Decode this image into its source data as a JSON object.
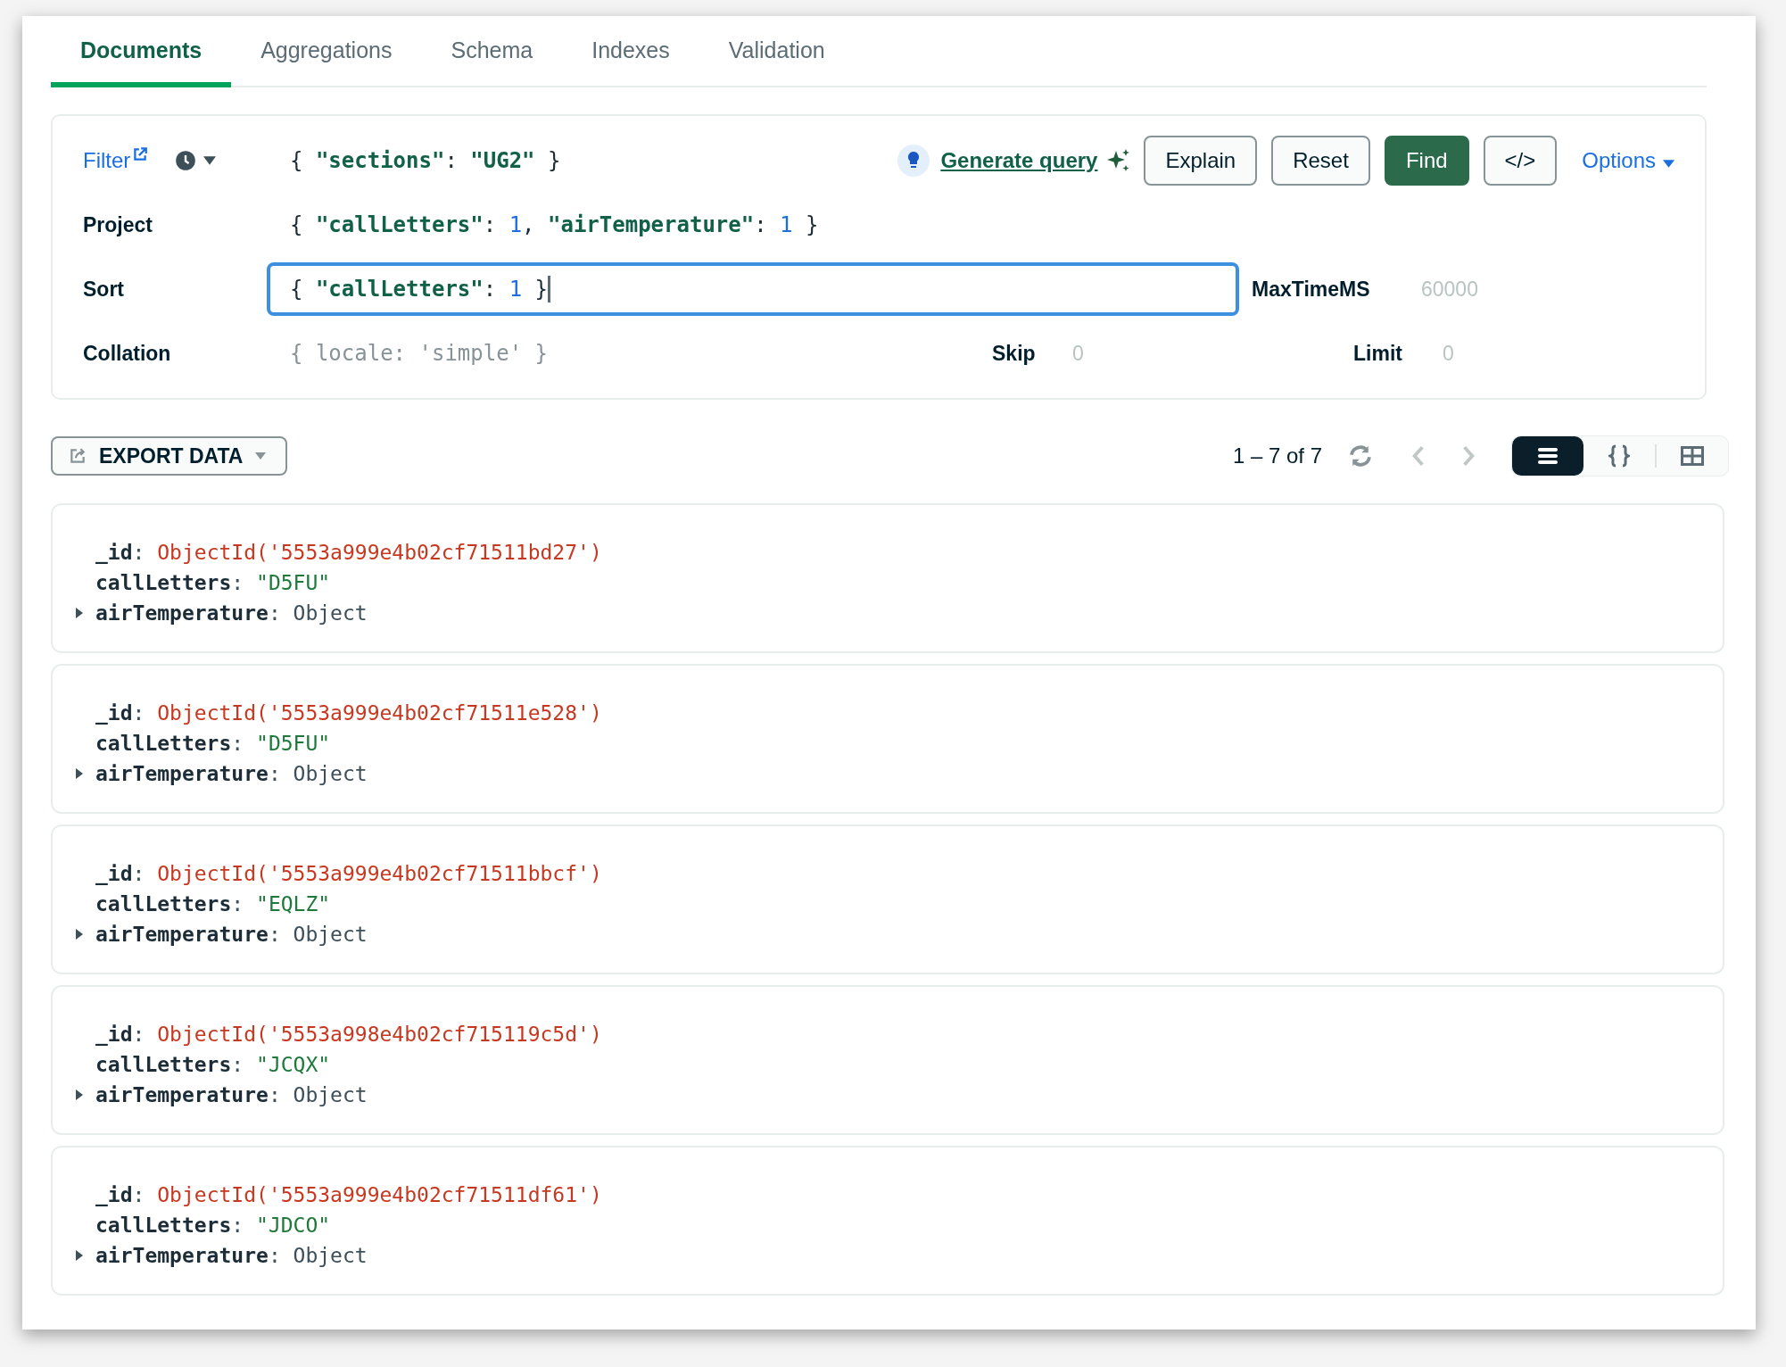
{
  "tabs": [
    {
      "label": "Documents",
      "selected": true
    },
    {
      "label": "Aggregations",
      "selected": false
    },
    {
      "label": "Schema",
      "selected": false
    },
    {
      "label": "Indexes",
      "selected": false
    },
    {
      "label": "Validation",
      "selected": false
    }
  ],
  "query": {
    "filter": {
      "label": "Filter",
      "value": "{ \"sections\": \"UG2\" }"
    },
    "generate_link": "Generate query",
    "buttons": [
      {
        "label": "Explain",
        "kind": "outline"
      },
      {
        "label": "Reset",
        "kind": "outline"
      },
      {
        "label": "Find",
        "kind": "primary"
      },
      {
        "label": "</>",
        "kind": "outline"
      }
    ],
    "options": "Options",
    "project": {
      "label": "Project",
      "value": "{ \"callLetters\": 1, \"airTemperature\": 1 }"
    },
    "sort": {
      "label": "Sort",
      "value": "{ \"callLetters\": 1 }",
      "focused": true
    },
    "maxtime": {
      "label": "MaxTimeMS",
      "placeholder": "60000"
    },
    "collation": {
      "label": "Collation",
      "placeholder": "{ locale: 'simple' }"
    },
    "skip": {
      "label": "Skip",
      "placeholder": "0"
    },
    "limit": {
      "label": "Limit",
      "placeholder": "0"
    }
  },
  "export_button": "EXPORT DATA",
  "pagination": "1 – 7 of 7",
  "views": [
    {
      "kind": "list",
      "selected": true
    },
    {
      "kind": "json",
      "selected": false
    },
    {
      "kind": "table",
      "selected": false
    }
  ],
  "documents": [
    {
      "fields": [
        {
          "key": "_id",
          "sep": ":",
          "value": "ObjectId('5553a999e4b02cf71511bd27')",
          "kind": "objectid"
        },
        {
          "key": "callLetters",
          "sep": ":",
          "value": "\"D5FU\"",
          "kind": "string"
        },
        {
          "key": "airTemperature",
          "sep": ":",
          "value": "Object",
          "kind": "object"
        }
      ]
    },
    {
      "fields": [
        {
          "key": "_id",
          "sep": ":",
          "value": "ObjectId('5553a999e4b02cf71511e528')",
          "kind": "objectid"
        },
        {
          "key": "callLetters",
          "sep": ":",
          "value": "\"D5FU\"",
          "kind": "string"
        },
        {
          "key": "airTemperature",
          "sep": ":",
          "value": "Object",
          "kind": "object"
        }
      ]
    },
    {
      "fields": [
        {
          "key": "_id",
          "sep": ":",
          "value": "ObjectId('5553a999e4b02cf71511bbcf')",
          "kind": "objectid"
        },
        {
          "key": "callLetters",
          "sep": ":",
          "value": "\"EQLZ\"",
          "kind": "string"
        },
        {
          "key": "airTemperature",
          "sep": ":",
          "value": "Object",
          "kind": "object"
        }
      ]
    },
    {
      "fields": [
        {
          "key": "_id",
          "sep": ":",
          "value": "ObjectId('5553a998e4b02cf715119c5d')",
          "kind": "objectid"
        },
        {
          "key": "callLetters",
          "sep": ":",
          "value": "\"JCQX\"",
          "kind": "string"
        },
        {
          "key": "airTemperature",
          "sep": ":",
          "value": "Object",
          "kind": "object"
        }
      ]
    },
    {
      "fields": [
        {
          "key": "_id",
          "sep": ":",
          "value": "ObjectId('5553a999e4b02cf71511df61')",
          "kind": "objectid"
        },
        {
          "key": "callLetters",
          "sep": ":",
          "value": "\"JDCO\"",
          "kind": "string"
        },
        {
          "key": "airTemperature",
          "sep": ":",
          "value": "Object",
          "kind": "object"
        }
      ]
    }
  ]
}
